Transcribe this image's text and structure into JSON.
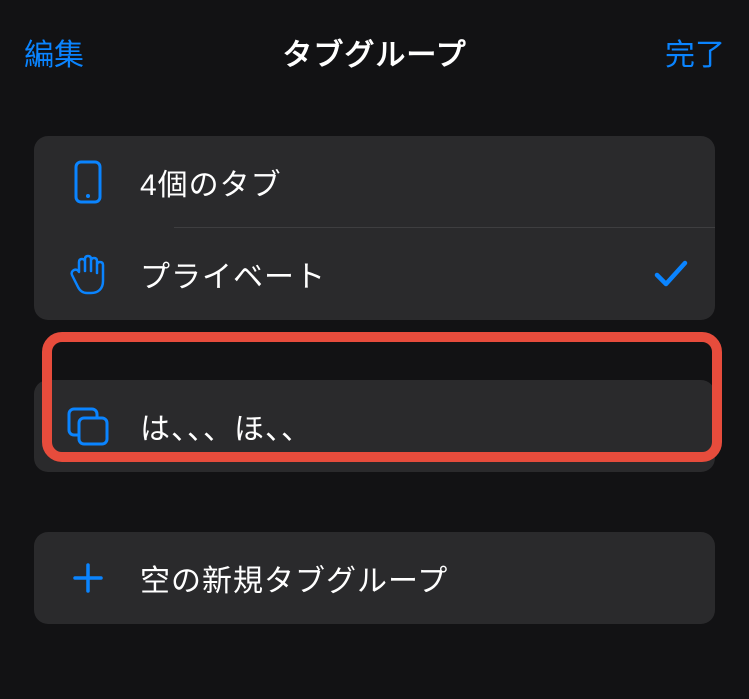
{
  "header": {
    "edit_label": "編集",
    "title": "タブグループ",
    "done_label": "完了"
  },
  "section1": {
    "tabs_row": {
      "label": "4個のタブ",
      "icon": "device-phone-icon"
    },
    "private_row": {
      "label": "プライベート",
      "icon": "hand-icon",
      "selected": true
    }
  },
  "section2": {
    "group_row": {
      "label": "は、、、ほ、、",
      "icon": "tab-group-icon"
    }
  },
  "section3": {
    "new_row": {
      "label": "空の新規タブグループ",
      "icon": "plus-icon"
    }
  },
  "colors": {
    "accent": "#0a84ff",
    "bg": "#121214",
    "row_bg": "#2a2a2c",
    "text": "#ffffff",
    "annotation": "#e74c3c"
  }
}
